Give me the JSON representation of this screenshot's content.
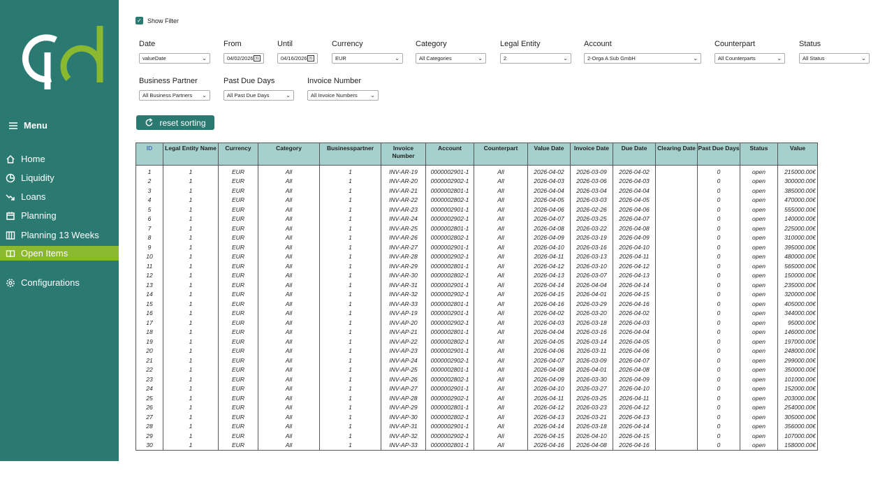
{
  "sidebar": {
    "menu_label": "Menu",
    "items": [
      {
        "label": "Home",
        "icon": "home-icon"
      },
      {
        "label": "Liquidity",
        "icon": "pie-chart-icon"
      },
      {
        "label": "Loans",
        "icon": "trend-down-icon"
      },
      {
        "label": "Planning",
        "icon": "calendar-icon"
      },
      {
        "label": "Planning 13 Weeks",
        "icon": "columns-icon"
      },
      {
        "label": "Open Items",
        "icon": "book-icon"
      },
      {
        "label": "Configurations",
        "icon": "gear-icon"
      }
    ],
    "active_item": "Open Items",
    "bg_color": "#2b7a72",
    "active_color": "#8ab82f"
  },
  "show_filter": {
    "label": "Show Filter",
    "checked": true
  },
  "filters": {
    "date": {
      "label": "Date",
      "value": "valueDate"
    },
    "from": {
      "label": "From",
      "value": "04/02/2026"
    },
    "until": {
      "label": "Until",
      "value": "04/16/2026"
    },
    "currency": {
      "label": "Currency",
      "value": "EUR"
    },
    "category": {
      "label": "Category",
      "value": "All Categories"
    },
    "legal_entity": {
      "label": "Legal Entity",
      "value": "2"
    },
    "account": {
      "label": "Account",
      "value": "2-Orga A Sub GmbH"
    },
    "counterpart": {
      "label": "Counterpart",
      "value": "All Counterparts"
    },
    "status": {
      "label": "Status",
      "value": "All Status"
    },
    "business_partner": {
      "label": "Business Partner",
      "value": "All Business Partners"
    },
    "past_due_days": {
      "label": "Past Due Days",
      "value": "All Past Due Days"
    },
    "invoice_number": {
      "label": "Invoice Number",
      "value": "All Invoice Numbers"
    }
  },
  "reset_button": {
    "label": "reset sorting"
  },
  "table": {
    "headers": [
      "ID",
      "Legal Entity Name",
      "Currency",
      "Category",
      "Businesspartner",
      "Invoice Number",
      "Account",
      "Counterpart",
      "Value Date",
      "Invoice Date",
      "Due Date",
      "Clearing Date",
      "Past Due Days",
      "Status",
      "Value"
    ],
    "rows": [
      [
        "1",
        "1",
        "EUR",
        "All",
        "1",
        "INV-AR-19",
        "0000002901-1",
        "All",
        "2026-04-02",
        "2026-03-09",
        "2026-04-02",
        "",
        "0",
        "open",
        "215000.00€"
      ],
      [
        "2",
        "1",
        "EUR",
        "All",
        "1",
        "INV-AR-20",
        "0000002902-1",
        "All",
        "2026-04-03",
        "2026-03-06",
        "2026-04-03",
        "",
        "0",
        "open",
        "300000.00€"
      ],
      [
        "3",
        "1",
        "EUR",
        "All",
        "1",
        "INV-AR-21",
        "0000002801-1",
        "All",
        "2026-04-04",
        "2026-03-04",
        "2026-04-04",
        "",
        "0",
        "open",
        "385000.00€"
      ],
      [
        "4",
        "1",
        "EUR",
        "All",
        "1",
        "INV-AR-22",
        "0000002802-1",
        "All",
        "2026-04-05",
        "2026-03-03",
        "2026-04-05",
        "",
        "0",
        "open",
        "470000.00€"
      ],
      [
        "5",
        "1",
        "EUR",
        "All",
        "1",
        "INV-AR-23",
        "0000002901-1",
        "All",
        "2026-04-06",
        "2026-02-26",
        "2026-04-06",
        "",
        "0",
        "open",
        "555000.00€"
      ],
      [
        "6",
        "1",
        "EUR",
        "All",
        "1",
        "INV-AR-24",
        "0000002902-1",
        "All",
        "2026-04-07",
        "2026-03-25",
        "2026-04-07",
        "",
        "0",
        "open",
        "140000.00€"
      ],
      [
        "7",
        "1",
        "EUR",
        "All",
        "1",
        "INV-AR-25",
        "0000002801-1",
        "All",
        "2026-04-08",
        "2026-03-22",
        "2026-04-08",
        "",
        "0",
        "open",
        "225000.00€"
      ],
      [
        "8",
        "1",
        "EUR",
        "All",
        "1",
        "INV-AR-26",
        "0000002802-1",
        "All",
        "2026-04-09",
        "2026-03-19",
        "2026-04-09",
        "",
        "0",
        "open",
        "310000.00€"
      ],
      [
        "9",
        "1",
        "EUR",
        "All",
        "1",
        "INV-AR-27",
        "0000002901-1",
        "All",
        "2026-04-10",
        "2026-03-16",
        "2026-04-10",
        "",
        "0",
        "open",
        "395000.00€"
      ],
      [
        "10",
        "1",
        "EUR",
        "All",
        "1",
        "INV-AR-28",
        "0000002902-1",
        "All",
        "2026-04-11",
        "2026-03-13",
        "2026-04-11",
        "",
        "0",
        "open",
        "480000.00€"
      ],
      [
        "11",
        "1",
        "EUR",
        "All",
        "1",
        "INV-AR-29",
        "0000002801-1",
        "All",
        "2026-04-12",
        "2026-03-10",
        "2026-04-12",
        "",
        "0",
        "open",
        "565000.00€"
      ],
      [
        "12",
        "1",
        "EUR",
        "All",
        "1",
        "INV-AR-30",
        "0000002802-1",
        "All",
        "2026-04-13",
        "2026-03-07",
        "2026-04-13",
        "",
        "0",
        "open",
        "150000.00€"
      ],
      [
        "13",
        "1",
        "EUR",
        "All",
        "1",
        "INV-AR-31",
        "0000002901-1",
        "All",
        "2026-04-14",
        "2026-04-04",
        "2026-04-14",
        "",
        "0",
        "open",
        "235000.00€"
      ],
      [
        "14",
        "1",
        "EUR",
        "All",
        "1",
        "INV-AR-32",
        "0000002902-1",
        "All",
        "2026-04-15",
        "2026-04-01",
        "2026-04-15",
        "",
        "0",
        "open",
        "320000.00€"
      ],
      [
        "15",
        "1",
        "EUR",
        "All",
        "1",
        "INV-AR-33",
        "0000002801-1",
        "All",
        "2026-04-16",
        "2026-03-29",
        "2026-04-16",
        "",
        "0",
        "open",
        "405000.00€"
      ],
      [
        "16",
        "1",
        "EUR",
        "All",
        "1",
        "INV-AP-19",
        "0000002901-1",
        "All",
        "2026-04-02",
        "2026-03-20",
        "2026-04-02",
        "",
        "0",
        "open",
        "344000.00€"
      ],
      [
        "17",
        "1",
        "EUR",
        "All",
        "1",
        "INV-AP-20",
        "0000002902-1",
        "All",
        "2026-04-03",
        "2026-03-18",
        "2026-04-03",
        "",
        "0",
        "open",
        "95000.00€"
      ],
      [
        "18",
        "1",
        "EUR",
        "All",
        "1",
        "INV-AP-21",
        "0000002801-1",
        "All",
        "2026-04-04",
        "2026-03-16",
        "2026-04-04",
        "",
        "0",
        "open",
        "146000.00€"
      ],
      [
        "19",
        "1",
        "EUR",
        "All",
        "1",
        "INV-AP-22",
        "0000002802-1",
        "All",
        "2026-04-05",
        "2026-03-14",
        "2026-04-05",
        "",
        "0",
        "open",
        "197000.00€"
      ],
      [
        "20",
        "1",
        "EUR",
        "All",
        "1",
        "INV-AP-23",
        "0000002901-1",
        "All",
        "2026-04-06",
        "2026-03-11",
        "2026-04-06",
        "",
        "0",
        "open",
        "248000.00€"
      ],
      [
        "21",
        "1",
        "EUR",
        "All",
        "1",
        "INV-AP-24",
        "0000002902-1",
        "All",
        "2026-04-07",
        "2026-03-09",
        "2026-04-07",
        "",
        "0",
        "open",
        "299000.00€"
      ],
      [
        "22",
        "1",
        "EUR",
        "All",
        "1",
        "INV-AP-25",
        "0000002801-1",
        "All",
        "2026-04-08",
        "2026-04-01",
        "2026-04-08",
        "",
        "0",
        "open",
        "350000.00€"
      ],
      [
        "23",
        "1",
        "EUR",
        "All",
        "1",
        "INV-AP-26",
        "0000002802-1",
        "All",
        "2026-04-09",
        "2026-03-30",
        "2026-04-09",
        "",
        "0",
        "open",
        "101000.00€"
      ],
      [
        "24",
        "1",
        "EUR",
        "All",
        "1",
        "INV-AP-27",
        "0000002901-1",
        "All",
        "2026-04-10",
        "2026-03-27",
        "2026-04-10",
        "",
        "0",
        "open",
        "152000.00€"
      ],
      [
        "25",
        "1",
        "EUR",
        "All",
        "1",
        "INV-AP-28",
        "0000002902-1",
        "All",
        "2026-04-11",
        "2026-03-25",
        "2026-04-11",
        "",
        "0",
        "open",
        "203000.00€"
      ],
      [
        "26",
        "1",
        "EUR",
        "All",
        "1",
        "INV-AP-29",
        "0000002801-1",
        "All",
        "2026-04-12",
        "2026-03-23",
        "2026-04-12",
        "",
        "0",
        "open",
        "254000.00€"
      ],
      [
        "27",
        "1",
        "EUR",
        "All",
        "1",
        "INV-AP-30",
        "0000002802-1",
        "All",
        "2026-04-13",
        "2026-03-21",
        "2026-04-13",
        "",
        "0",
        "open",
        "305000.00€"
      ],
      [
        "28",
        "1",
        "EUR",
        "All",
        "1",
        "INV-AP-31",
        "0000002901-1",
        "All",
        "2026-04-14",
        "2026-03-18",
        "2026-04-14",
        "",
        "0",
        "open",
        "356000.00€"
      ],
      [
        "29",
        "1",
        "EUR",
        "All",
        "1",
        "INV-AP-32",
        "0000002902-1",
        "All",
        "2026-04-15",
        "2026-04-10",
        "2026-04-15",
        "",
        "0",
        "open",
        "107000.00€"
      ],
      [
        "30",
        "1",
        "EUR",
        "All",
        "1",
        "INV-AP-33",
        "0000002801-1",
        "All",
        "2026-04-16",
        "2026-04-08",
        "2026-04-16",
        "",
        "0",
        "open",
        "158000.00€"
      ]
    ]
  }
}
